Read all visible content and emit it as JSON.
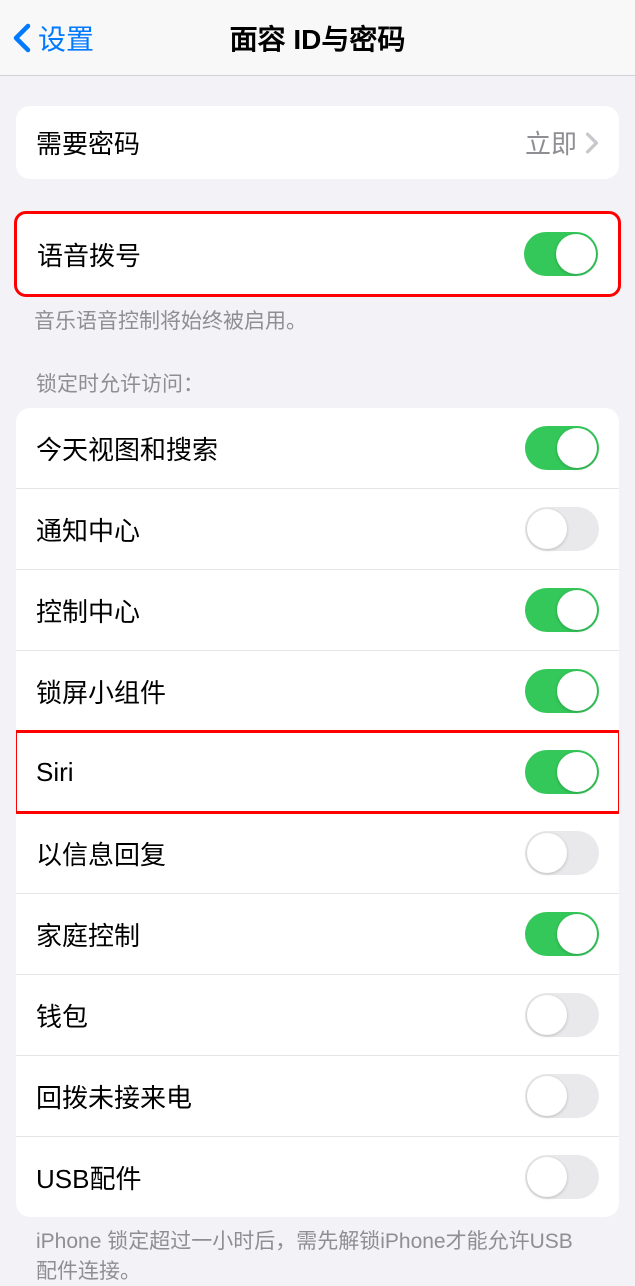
{
  "nav": {
    "back_label": "设置",
    "title": "面容 ID与密码"
  },
  "group1": {
    "require_passcode_label": "需要密码",
    "require_passcode_value": "立即"
  },
  "group2": {
    "voice_dial_label": "语音拨号",
    "voice_dial_on": true,
    "footer": "音乐语音控制将始终被启用。"
  },
  "group3": {
    "header": "锁定时允许访问：",
    "items": [
      {
        "label": "今天视图和搜索",
        "on": true,
        "highlight": false
      },
      {
        "label": "通知中心",
        "on": false,
        "highlight": false
      },
      {
        "label": "控制中心",
        "on": true,
        "highlight": false
      },
      {
        "label": "锁屏小组件",
        "on": true,
        "highlight": false
      },
      {
        "label": "Siri",
        "on": true,
        "highlight": true
      },
      {
        "label": "以信息回复",
        "on": false,
        "highlight": false
      },
      {
        "label": "家庭控制",
        "on": true,
        "highlight": false
      },
      {
        "label": "钱包",
        "on": false,
        "highlight": false
      },
      {
        "label": "回拨未接来电",
        "on": false,
        "highlight": false
      },
      {
        "label": "USB配件",
        "on": false,
        "highlight": false
      }
    ],
    "footer": "iPhone 锁定超过一小时后，需先解锁iPhone才能允许USB 配件连接。"
  }
}
